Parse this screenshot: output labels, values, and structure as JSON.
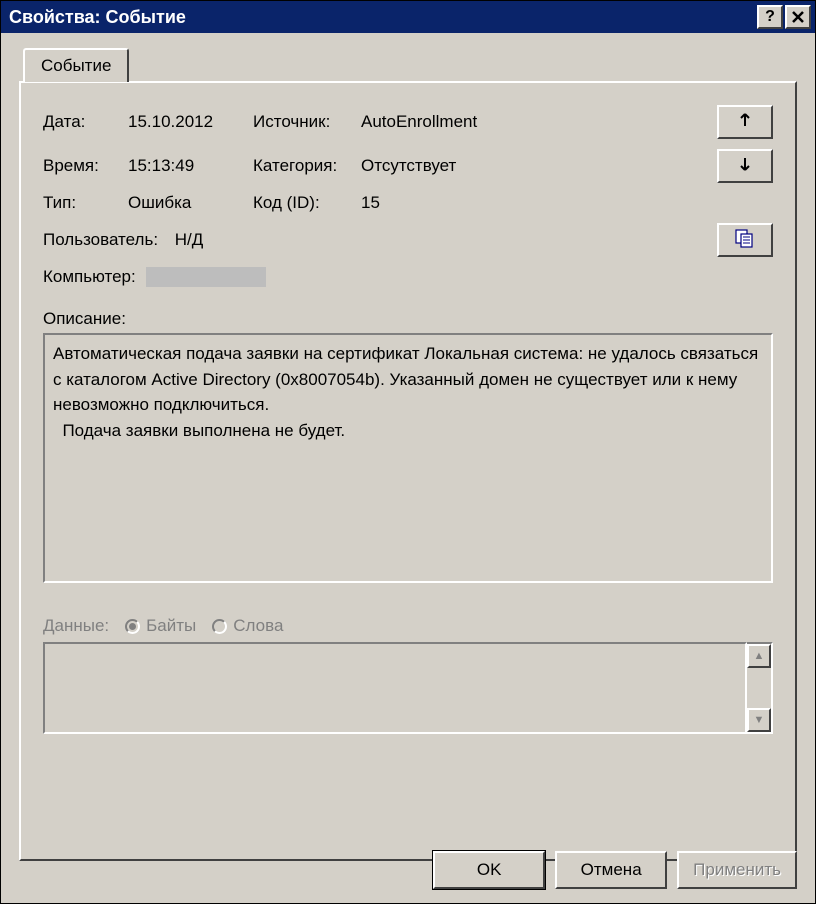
{
  "window": {
    "title": "Свойства: Событие"
  },
  "tabs": {
    "event": "Событие"
  },
  "labels": {
    "date": "Дата:",
    "time": "Время:",
    "type": "Тип:",
    "user": "Пользователь:",
    "computer": "Компьютер:",
    "source": "Источник:",
    "category": "Категория:",
    "code": "Код (ID):",
    "description": "Описание:",
    "data": "Данные:",
    "bytes": "Байты",
    "words": "Слова"
  },
  "values": {
    "date": "15.10.2012",
    "time": "15:13:49",
    "type": "Ошибка",
    "user": "Н/Д",
    "computer": "",
    "source": "AutoEnrollment",
    "category": "Отсутствует",
    "code": "15"
  },
  "description_text": "Автоматическая подача заявки на сертификат Локальная система: не удалось связаться с каталогом Active Directory (0x8007054b). Указанный домен не существует или к нему невозможно подключиться.\n  Подача заявки выполнена не будет.",
  "data_text": "",
  "buttons": {
    "ok": "OK",
    "cancel": "Отмена",
    "apply": "Применить"
  }
}
